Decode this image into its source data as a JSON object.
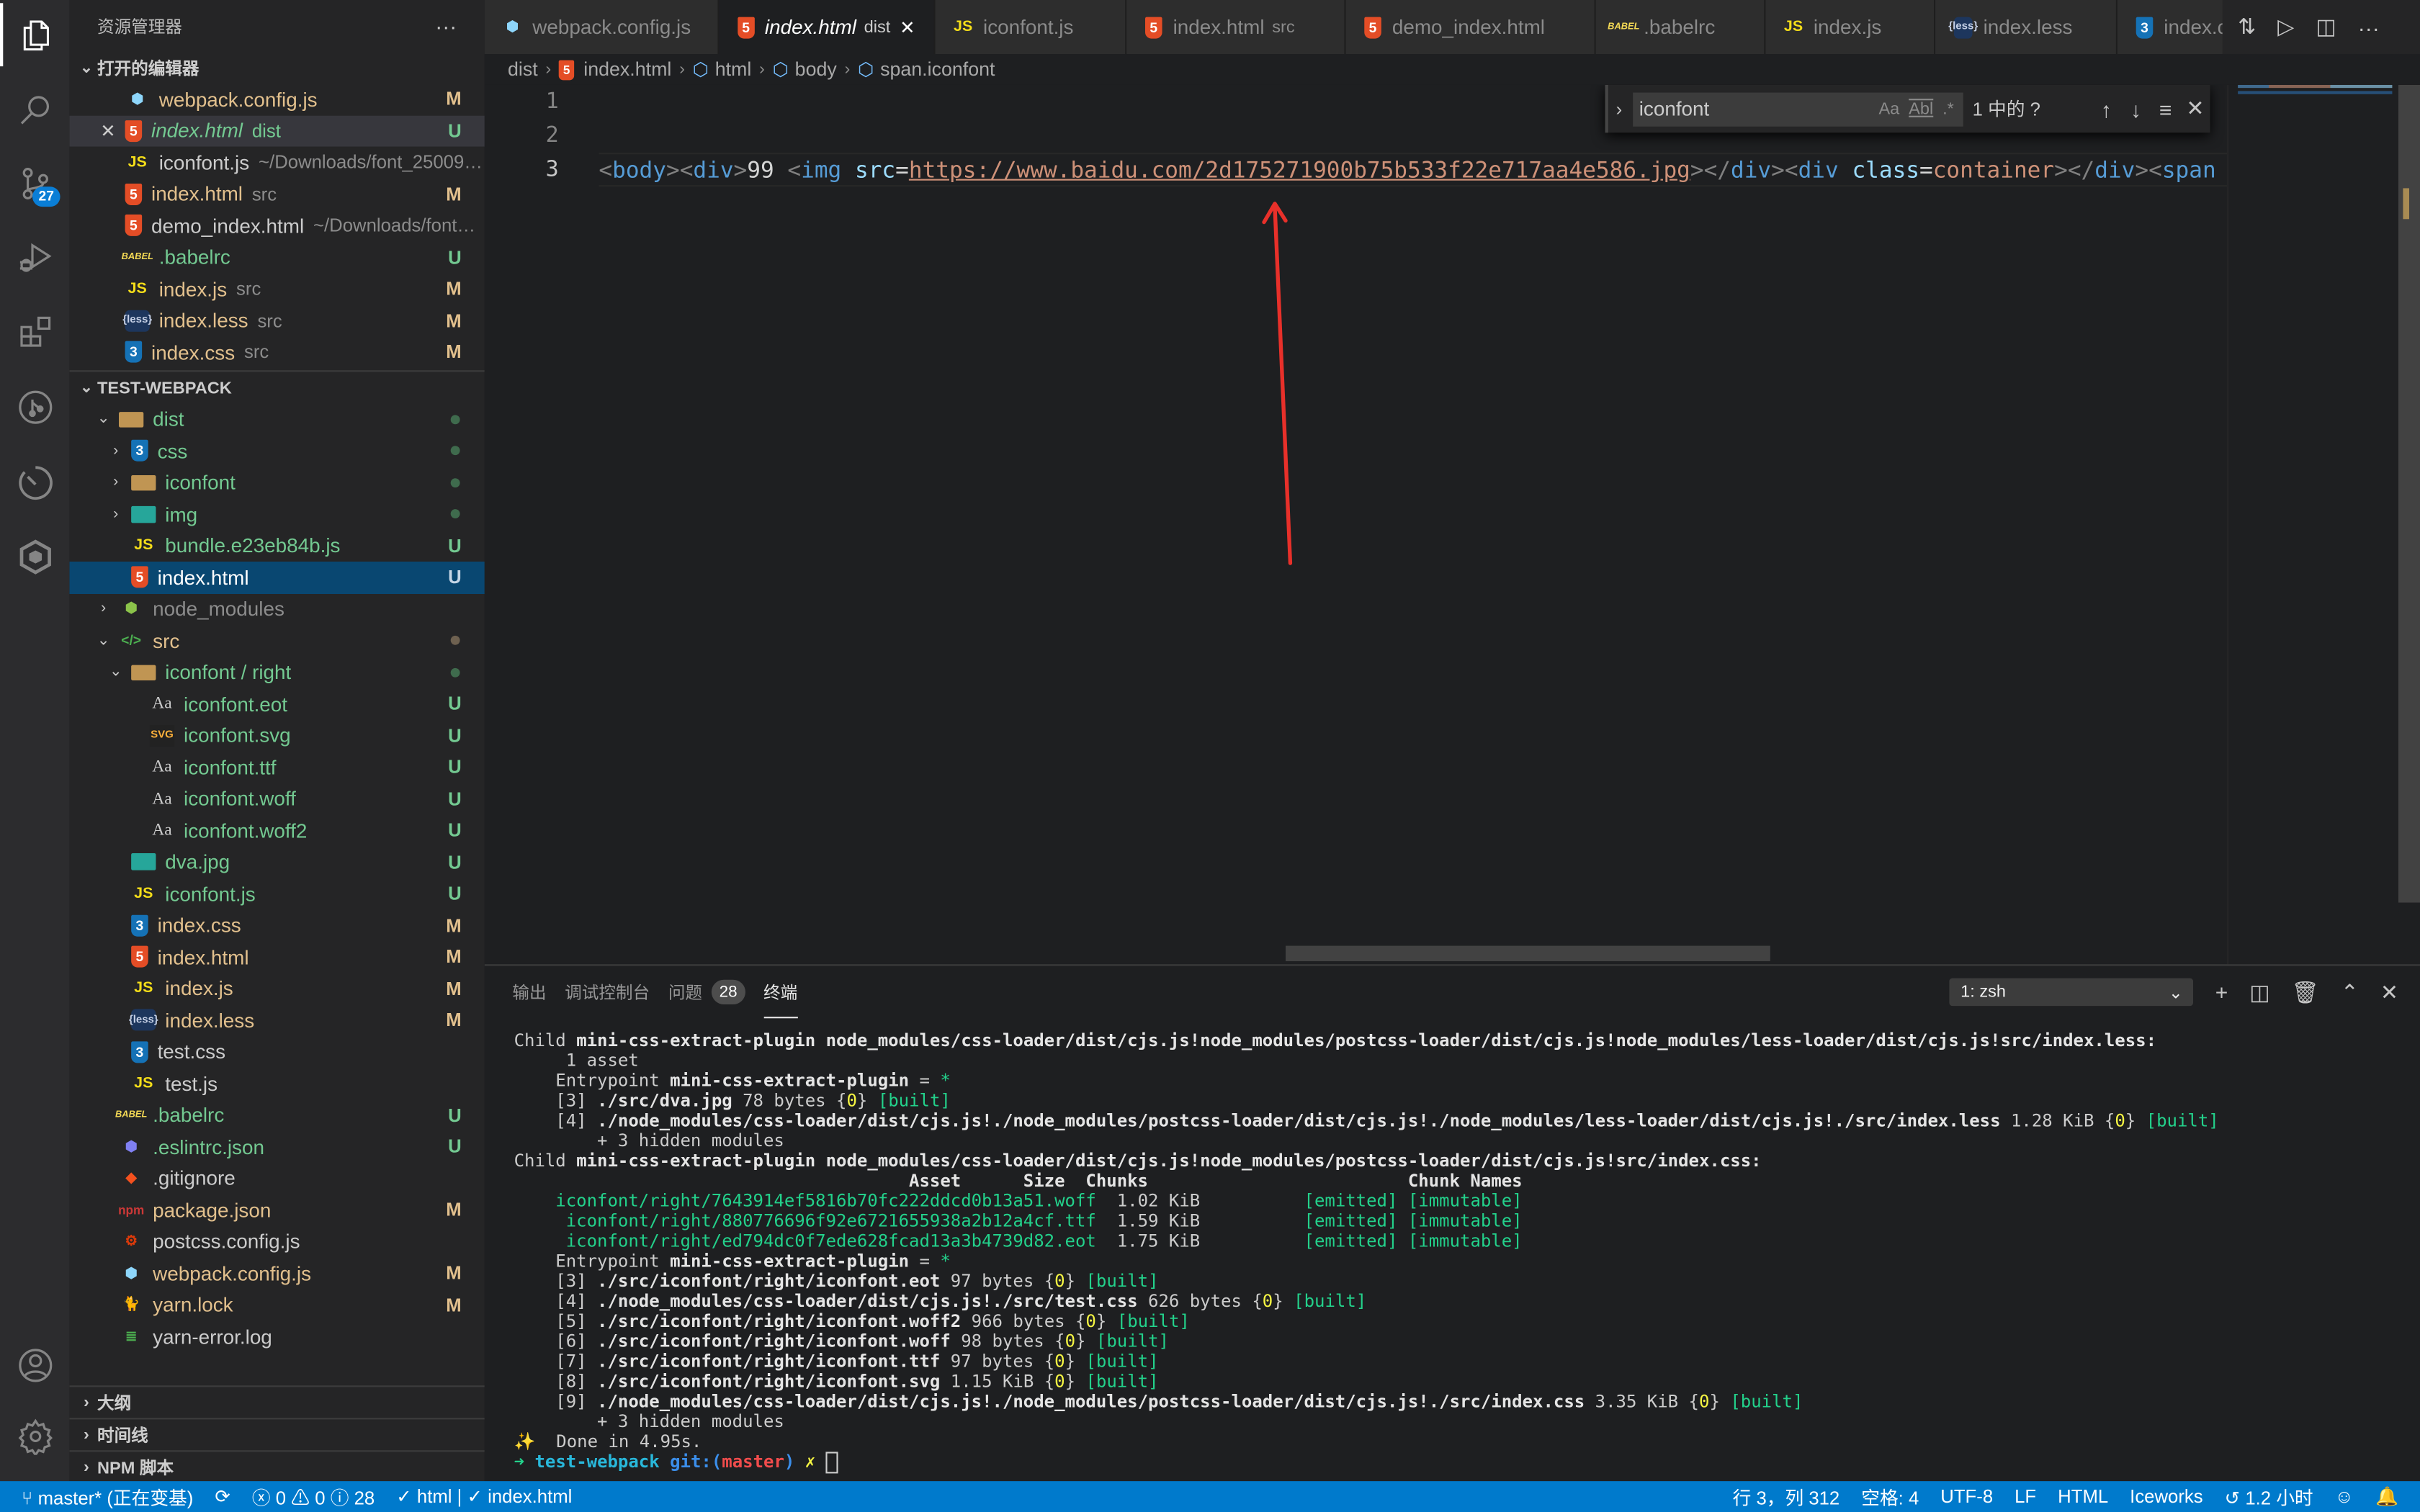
{
  "activity_bar": {
    "items": [
      {
        "name": "explorer",
        "active": true
      },
      {
        "name": "search"
      },
      {
        "name": "source-control",
        "badge": "27"
      },
      {
        "name": "run-debug"
      },
      {
        "name": "extensions"
      },
      {
        "name": "gitlens"
      },
      {
        "name": "timeline"
      },
      {
        "name": "iceworks"
      }
    ],
    "bottom": [
      {
        "name": "accounts"
      },
      {
        "name": "settings"
      }
    ]
  },
  "sidebar": {
    "title": "资源管理器",
    "more": "···",
    "open_editors": {
      "label": "打开的编辑器",
      "items": [
        {
          "icon": "webpack",
          "name": "webpack.config.js",
          "desc": "",
          "status": "M",
          "cls": "mod"
        },
        {
          "icon": "html",
          "name": "index.html",
          "desc": "dist",
          "status": "U",
          "cls": "unt",
          "hover": true,
          "italic": true,
          "close": "✕"
        },
        {
          "icon": "js",
          "name": "iconfont.js",
          "desc": "~/Downloads/font_2500948_t...",
          "status": "",
          "cls": "plain"
        },
        {
          "icon": "html",
          "name": "index.html",
          "desc": "src",
          "status": "M",
          "cls": "mod"
        },
        {
          "icon": "html",
          "name": "demo_index.html",
          "desc": "~/Downloads/font_250...",
          "status": "",
          "cls": "plain"
        },
        {
          "icon": "babel",
          "name": ".babelrc",
          "desc": "",
          "status": "U",
          "cls": "unt"
        },
        {
          "icon": "js",
          "name": "index.js",
          "desc": "src",
          "status": "M",
          "cls": "mod"
        },
        {
          "icon": "less",
          "name": "index.less",
          "desc": "src",
          "status": "M",
          "cls": "mod"
        },
        {
          "icon": "css",
          "name": "index.css",
          "desc": "src",
          "status": "M",
          "cls": "mod"
        }
      ]
    },
    "workspace": {
      "label": "TEST-WEBPACK",
      "tree": [
        {
          "depth": 1,
          "arrow": "⌄",
          "icon": "folder-dist",
          "name": "dist",
          "cls": "unt",
          "dot": "#3f6b4d"
        },
        {
          "depth": 2,
          "arrow": "›",
          "icon": "folder-css",
          "name": "css",
          "cls": "unt",
          "dot": "#3f6b4d"
        },
        {
          "depth": 2,
          "arrow": "›",
          "icon": "folder",
          "name": "iconfont",
          "cls": "unt",
          "dot": "#3f6b4d"
        },
        {
          "depth": 2,
          "arrow": "›",
          "icon": "folder-img",
          "name": "img",
          "cls": "unt",
          "dot": "#3f6b4d"
        },
        {
          "depth": 2,
          "arrow": "",
          "icon": "js",
          "name": "bundle.e23eb84b.js",
          "cls": "unt",
          "status": "U"
        },
        {
          "depth": 2,
          "arrow": "",
          "icon": "html",
          "name": "index.html",
          "cls": "selected-text",
          "status": "U",
          "selected": true
        },
        {
          "depth": 1,
          "arrow": "›",
          "icon": "folder-node",
          "name": "node_modules",
          "cls": "ign"
        },
        {
          "depth": 1,
          "arrow": "⌄",
          "icon": "folder-src",
          "name": "src",
          "cls": "mod",
          "dot": "#6e6150"
        },
        {
          "depth": 2,
          "arrow": "⌄",
          "icon": "folder-open",
          "name": "iconfont / right",
          "cls": "unt",
          "dot": "#3f6b4d"
        },
        {
          "depth": 3,
          "arrow": "",
          "icon": "font",
          "name": "iconfont.eot",
          "cls": "unt",
          "status": "U"
        },
        {
          "depth": 3,
          "arrow": "",
          "icon": "svg",
          "name": "iconfont.svg",
          "cls": "unt",
          "status": "U"
        },
        {
          "depth": 3,
          "arrow": "",
          "icon": "font",
          "name": "iconfont.ttf",
          "cls": "unt",
          "status": "U"
        },
        {
          "depth": 3,
          "arrow": "",
          "icon": "font",
          "name": "iconfont.woff",
          "cls": "unt",
          "status": "U"
        },
        {
          "depth": 3,
          "arrow": "",
          "icon": "font",
          "name": "iconfont.woff2",
          "cls": "unt",
          "status": "U"
        },
        {
          "depth": 2,
          "arrow": "",
          "icon": "image",
          "name": "dva.jpg",
          "cls": "unt",
          "status": "U"
        },
        {
          "depth": 2,
          "arrow": "",
          "icon": "js",
          "name": "iconfont.js",
          "cls": "unt",
          "status": "U"
        },
        {
          "depth": 2,
          "arrow": "",
          "icon": "css",
          "name": "index.css",
          "cls": "mod",
          "status": "M"
        },
        {
          "depth": 2,
          "arrow": "",
          "icon": "html",
          "name": "index.html",
          "cls": "mod",
          "status": "M"
        },
        {
          "depth": 2,
          "arrow": "",
          "icon": "js",
          "name": "index.js",
          "cls": "mod",
          "status": "M"
        },
        {
          "depth": 2,
          "arrow": "",
          "icon": "less",
          "name": "index.less",
          "cls": "mod",
          "status": "M"
        },
        {
          "depth": 2,
          "arrow": "",
          "icon": "css",
          "name": "test.css",
          "cls": "plain"
        },
        {
          "depth": 2,
          "arrow": "",
          "icon": "js",
          "name": "test.js",
          "cls": "plain"
        },
        {
          "depth": 1,
          "arrow": "",
          "icon": "babel",
          "name": ".babelrc",
          "cls": "unt",
          "status": "U"
        },
        {
          "depth": 1,
          "arrow": "",
          "icon": "eslint",
          "name": ".eslintrc.json",
          "cls": "unt",
          "status": "U"
        },
        {
          "depth": 1,
          "arrow": "",
          "icon": "git",
          "name": ".gitignore",
          "cls": "plain"
        },
        {
          "depth": 1,
          "arrow": "",
          "icon": "npm",
          "name": "package.json",
          "cls": "mod",
          "status": "M"
        },
        {
          "depth": 1,
          "arrow": "",
          "icon": "postcss",
          "name": "postcss.config.js",
          "cls": "plain"
        },
        {
          "depth": 1,
          "arrow": "",
          "icon": "webpack",
          "name": "webpack.config.js",
          "cls": "mod",
          "status": "M"
        },
        {
          "depth": 1,
          "arrow": "",
          "icon": "yarn",
          "name": "yarn.lock",
          "cls": "mod",
          "status": "M"
        },
        {
          "depth": 1,
          "arrow": "",
          "icon": "log",
          "name": "yarn-error.log",
          "cls": "plain"
        }
      ]
    },
    "bottom_sections": [
      "大纲",
      "时间线",
      "NPM 脚本"
    ]
  },
  "tabs": [
    {
      "icon": "webpack",
      "name": "webpack.config.js",
      "desc": ""
    },
    {
      "icon": "html",
      "name": "index.html",
      "desc": "dist",
      "active": true,
      "close": "✕"
    },
    {
      "icon": "js",
      "name": "iconfont.js",
      "desc": ""
    },
    {
      "icon": "html",
      "name": "index.html",
      "desc": "src"
    },
    {
      "icon": "html",
      "name": "demo_index.html",
      "desc": ""
    },
    {
      "icon": "babel",
      "name": ".babelrc",
      "desc": ""
    },
    {
      "icon": "js",
      "name": "index.js",
      "desc": ""
    },
    {
      "icon": "less",
      "name": "index.less",
      "desc": ""
    },
    {
      "icon": "css",
      "name": "index.css",
      "desc": ""
    }
  ],
  "tab_actions": [
    "open-changes",
    "run",
    "split-editor",
    "more"
  ],
  "breadcrumb": [
    "dist",
    "index.html",
    "html",
    "body",
    "span.iconfont"
  ],
  "editor": {
    "line_numbers": [
      "1",
      "2",
      "3"
    ],
    "line3_tokens": [
      {
        "t": "<",
        "c": "t-punc"
      },
      {
        "t": "body",
        "c": "t-tag"
      },
      {
        "t": ">",
        "c": "t-punc"
      },
      {
        "t": "<",
        "c": "t-punc"
      },
      {
        "t": "div",
        "c": "t-tag"
      },
      {
        "t": ">",
        "c": "t-punc"
      },
      {
        "t": "99 ",
        "c": "t-txt"
      },
      {
        "t": "<",
        "c": "t-punc"
      },
      {
        "t": "img",
        "c": "t-tag"
      },
      {
        "t": " ",
        "c": "t-txt"
      },
      {
        "t": "src",
        "c": "t-attr"
      },
      {
        "t": "=",
        "c": "t-eq"
      },
      {
        "t": "https://www.baidu.com/2d175271900b75b533f22e717aa4e586.jpg",
        "c": "t-link"
      },
      {
        "t": "></",
        "c": "t-punc"
      },
      {
        "t": "div",
        "c": "t-tag"
      },
      {
        "t": ">",
        "c": "t-punc"
      },
      {
        "t": "<",
        "c": "t-punc"
      },
      {
        "t": "div",
        "c": "t-tag"
      },
      {
        "t": " ",
        "c": "t-txt"
      },
      {
        "t": "class",
        "c": "t-attr"
      },
      {
        "t": "=",
        "c": "t-eq"
      },
      {
        "t": "container",
        "c": "t-val"
      },
      {
        "t": "></",
        "c": "t-punc"
      },
      {
        "t": "div",
        "c": "t-tag"
      },
      {
        "t": ">",
        "c": "t-punc"
      },
      {
        "t": "<",
        "c": "t-punc"
      },
      {
        "t": "span",
        "c": "t-tag"
      }
    ]
  },
  "find_widget": {
    "query": "iconfont",
    "options": [
      "Aa",
      "Abl",
      ".*"
    ],
    "count": "1 中的 ?"
  },
  "panel": {
    "tabs": [
      {
        "label": "输出"
      },
      {
        "label": "调试控制台"
      },
      {
        "label": "问题",
        "badge": "28"
      },
      {
        "label": "终端",
        "active": true
      }
    ],
    "terminal_select": "1: zsh",
    "terminal_lines": [
      [
        {
          "t": "Child "
        },
        {
          "t": "mini-css-extract-plugin node_modules/css-loader/dist/cjs.js!node_modules/postcss-loader/dist/cjs.js!node_modules/less-loader/dist/cjs.js!src/index.less:",
          "c": "b"
        }
      ],
      [
        {
          "t": "     1 asset"
        }
      ],
      [
        {
          "t": "    Entrypoint "
        },
        {
          "t": "mini-css-extract-plugin",
          "c": "b"
        },
        {
          "t": " = "
        },
        {
          "t": "*",
          "c": "g"
        }
      ],
      [
        {
          "t": "    [3] "
        },
        {
          "t": "./src/dva.jpg",
          "c": "b"
        },
        {
          "t": " 78 bytes {"
        },
        {
          "t": "0",
          "c": "y"
        },
        {
          "t": "} "
        },
        {
          "t": "[built]",
          "c": "g"
        }
      ],
      [
        {
          "t": "    [4] "
        },
        {
          "t": "./node_modules/css-loader/dist/cjs.js!./node_modules/postcss-loader/dist/cjs.js!./node_modules/less-loader/dist/cjs.js!./src/index.less",
          "c": "b"
        },
        {
          "t": " 1.28 KiB {"
        },
        {
          "t": "0",
          "c": "y"
        },
        {
          "t": "} "
        },
        {
          "t": "[built]",
          "c": "g"
        }
      ],
      [
        {
          "t": "        + 3 hidden modules"
        }
      ],
      [
        {
          "t": "Child "
        },
        {
          "t": "mini-css-extract-plugin node_modules/css-loader/dist/cjs.js!node_modules/postcss-loader/dist/cjs.js!src/index.css:",
          "c": "b"
        }
      ],
      [
        {
          "t": "                                      Asset      Size  Chunks                         Chunk Names",
          "c": "b"
        }
      ],
      [
        {
          "t": "    iconfont/right/7643914ef5816b70fc222ddcd0b13a51.woff",
          "c": "g"
        },
        {
          "t": "  1.02 KiB          "
        },
        {
          "t": "[emitted] [immutable]",
          "c": "g"
        }
      ],
      [
        {
          "t": "     iconfont/right/880776696f92e6721655938a2b12a4cf.ttf",
          "c": "g"
        },
        {
          "t": "  1.59 KiB          "
        },
        {
          "t": "[emitted] [immutable]",
          "c": "g"
        }
      ],
      [
        {
          "t": "     iconfont/right/ed794dc0f7ede628fcad13a3b4739d82.eot",
          "c": "g"
        },
        {
          "t": "  1.75 KiB          "
        },
        {
          "t": "[emitted] [immutable]",
          "c": "g"
        }
      ],
      [
        {
          "t": "    Entrypoint "
        },
        {
          "t": "mini-css-extract-plugin",
          "c": "b"
        },
        {
          "t": " = "
        },
        {
          "t": "*",
          "c": "g"
        }
      ],
      [
        {
          "t": "    [3] "
        },
        {
          "t": "./src/iconfont/right/iconfont.eot",
          "c": "b"
        },
        {
          "t": " 97 bytes {"
        },
        {
          "t": "0",
          "c": "y"
        },
        {
          "t": "} "
        },
        {
          "t": "[built]",
          "c": "g"
        }
      ],
      [
        {
          "t": "    [4] "
        },
        {
          "t": "./node_modules/css-loader/dist/cjs.js!./src/test.css",
          "c": "b"
        },
        {
          "t": " 626 bytes {"
        },
        {
          "t": "0",
          "c": "y"
        },
        {
          "t": "} "
        },
        {
          "t": "[built]",
          "c": "g"
        }
      ],
      [
        {
          "t": "    [5] "
        },
        {
          "t": "./src/iconfont/right/iconfont.woff2",
          "c": "b"
        },
        {
          "t": " 966 bytes {"
        },
        {
          "t": "0",
          "c": "y"
        },
        {
          "t": "} "
        },
        {
          "t": "[built]",
          "c": "g"
        }
      ],
      [
        {
          "t": "    [6] "
        },
        {
          "t": "./src/iconfont/right/iconfont.woff",
          "c": "b"
        },
        {
          "t": " 98 bytes {"
        },
        {
          "t": "0",
          "c": "y"
        },
        {
          "t": "} "
        },
        {
          "t": "[built]",
          "c": "g"
        }
      ],
      [
        {
          "t": "    [7] "
        },
        {
          "t": "./src/iconfont/right/iconfont.ttf",
          "c": "b"
        },
        {
          "t": " 97 bytes {"
        },
        {
          "t": "0",
          "c": "y"
        },
        {
          "t": "} "
        },
        {
          "t": "[built]",
          "c": "g"
        }
      ],
      [
        {
          "t": "    [8] "
        },
        {
          "t": "./src/iconfont/right/iconfont.svg",
          "c": "b"
        },
        {
          "t": " 1.15 KiB {"
        },
        {
          "t": "0",
          "c": "y"
        },
        {
          "t": "} "
        },
        {
          "t": "[built]",
          "c": "g"
        }
      ],
      [
        {
          "t": "    [9] "
        },
        {
          "t": "./node_modules/css-loader/dist/cjs.js!./node_modules/postcss-loader/dist/cjs.js!./src/index.css",
          "c": "b"
        },
        {
          "t": " 3.35 KiB {"
        },
        {
          "t": "0",
          "c": "y"
        },
        {
          "t": "} "
        },
        {
          "t": "[built]",
          "c": "g"
        }
      ],
      [
        {
          "t": "        + 3 hidden modules"
        }
      ],
      [
        {
          "t": "✨",
          "c": "y"
        },
        {
          "t": "  Done in 4.95s."
        }
      ],
      [
        {
          "t": "➜ ",
          "c": "g"
        },
        {
          "t": "test-webpack",
          "c": "c"
        },
        {
          "t": " git:(",
          "c": "bl"
        },
        {
          "t": "master",
          "c": "r"
        },
        {
          "t": ")",
          "c": "bl"
        },
        {
          "t": " ✗ ",
          "c": "y"
        },
        {
          "t": "",
          "cursor": true
        }
      ]
    ]
  },
  "status_bar": {
    "branch": "master* (正在变基)",
    "errors": "0",
    "warnings": "0",
    "infos": "28",
    "lint": "✓ html | ✓ index.html",
    "position": "行 3，列 312",
    "spaces": "空格: 4",
    "encoding": "UTF-8",
    "eol": "LF",
    "language": "HTML",
    "iceworks": "Iceworks",
    "time": "1.2 小时"
  },
  "colors": {
    "accent": "#007acc",
    "modified": "#e2c08d",
    "untracked": "#73c991",
    "annotation_arrow": "#e8302a"
  }
}
